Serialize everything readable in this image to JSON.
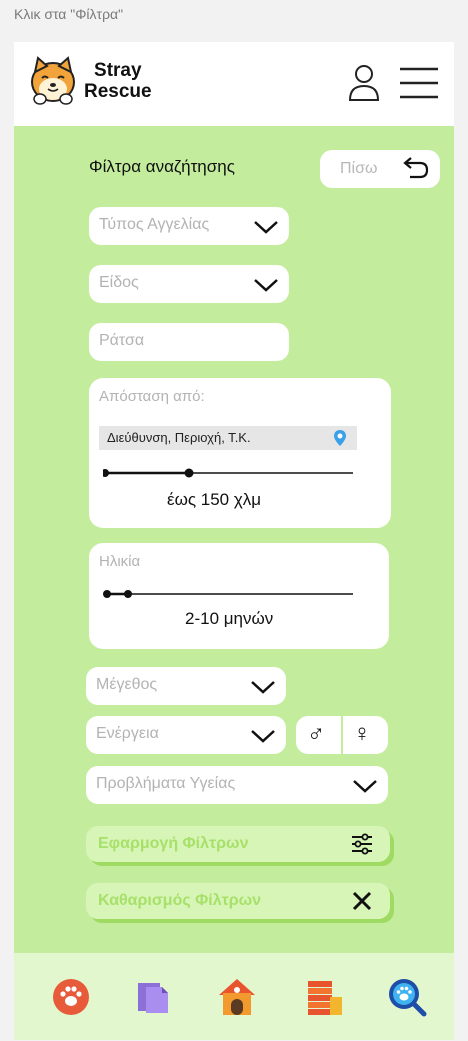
{
  "caption": "Κλικ στα \"Φίλτρα\"",
  "brand": {
    "line1": "Stray",
    "line2": "Rescue"
  },
  "header": {
    "logo": "shiba-dog-logo",
    "user_icon": "user-icon",
    "menu_icon": "hamburger-menu-icon"
  },
  "filters": {
    "title": "Φίλτρα αναζήτησης",
    "back_label": "Πίσω",
    "listing_type_placeholder": "Τύπος Αγγελίας",
    "species_placeholder": "Είδος",
    "breed_placeholder": "Ράτσα",
    "distance": {
      "label": "Απόσταση από:",
      "address_placeholder": "Διεύθυνση, Περιοχή, Τ.Κ.",
      "value_text": "έως 150 χλμ",
      "slider_fraction": 0.34
    },
    "age": {
      "label": "Ηλικία",
      "value_text": "2-10 μηνών",
      "range_fraction": [
        0.02,
        0.1
      ]
    },
    "size_placeholder": "Μέγεθος",
    "energy_placeholder": "Ενέργεια",
    "gender": {
      "male": "♂",
      "female": "♀"
    },
    "health_placeholder": "Προβλήματα Υγείας",
    "apply_label": "Εφαρμογή Φίλτρων",
    "clear_label": "Καθαρισμός Φίλτρων"
  },
  "colors": {
    "background": "#c3ec9c",
    "accent_light": "#d7f5b6",
    "accent_text": "#a7e06a",
    "nav_bg": "#e3f7cf"
  },
  "nav": [
    "paw-icon",
    "documents-icon",
    "shelter-house-icon",
    "coins-icon",
    "search-paw-icon"
  ]
}
